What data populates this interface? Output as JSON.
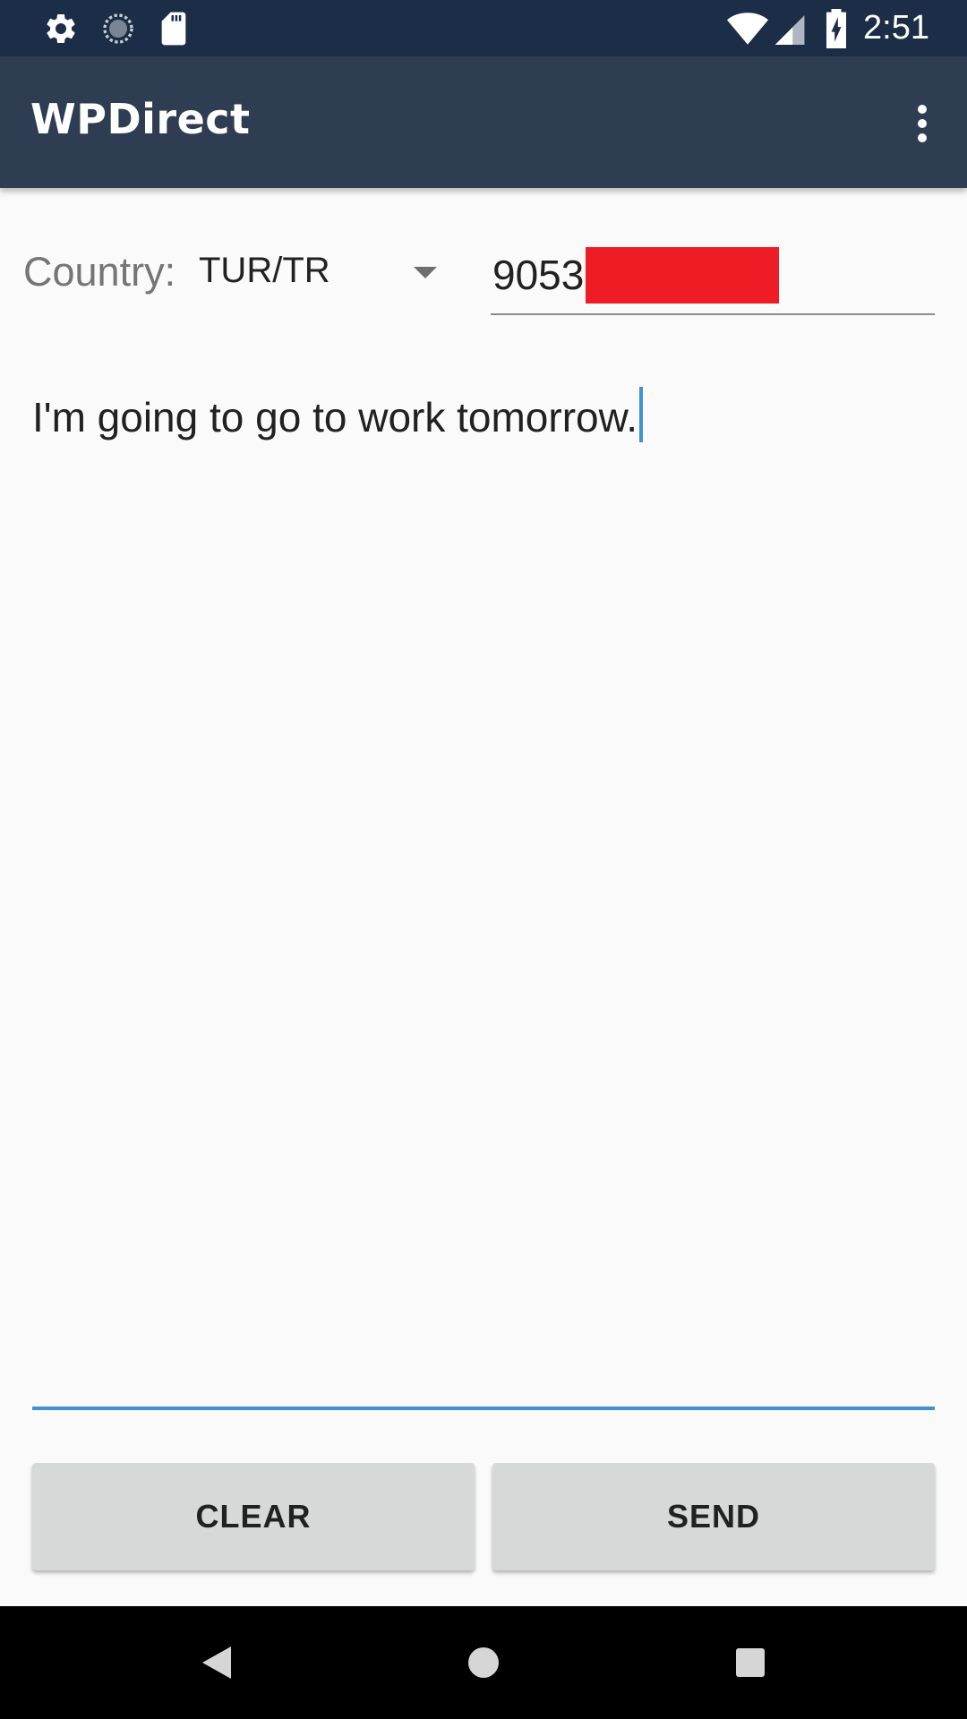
{
  "status_bar": {
    "time": "2:51",
    "left_icons": [
      "settings-icon",
      "sync-icon",
      "sd-card-icon"
    ],
    "right_icons": [
      "wifi-icon",
      "signal-icon",
      "battery-charging-icon"
    ]
  },
  "app_bar": {
    "title": "WPDirect",
    "menu_icon": "more-vert-icon"
  },
  "form": {
    "country_label": "Country:",
    "country_value": "TUR/TR",
    "phone_value": "9053",
    "phone_redacted": true,
    "message_value": "I'm going to go to work tomorrow."
  },
  "buttons": {
    "clear_label": "CLEAR",
    "send_label": "SEND"
  },
  "nav_bar": {
    "icons": [
      "back-icon",
      "home-icon",
      "recents-icon"
    ]
  },
  "colors": {
    "status_bar": "#1c2e47",
    "app_bar": "#2e3d51",
    "accent": "#3d93d4",
    "redaction": "#ee1c25",
    "button_bg": "#d7d8d8",
    "background": "#fafafa"
  }
}
